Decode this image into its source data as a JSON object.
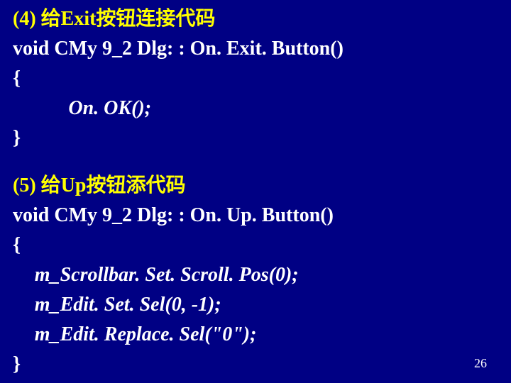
{
  "section4": {
    "heading": "(4) 给Exit按钮连接代码",
    "line1": "void CMy 9_2 Dlg: : On. Exit. Button()",
    "line2": "{",
    "call": "On. OK();",
    "line3": "}"
  },
  "section5": {
    "heading": "(5) 给Up按钮添代码",
    "line1": "void CMy 9_2 Dlg: : On. Up. Button()",
    "line2": "{",
    "call1": "m_Scrollbar. Set. Scroll. Pos(0);",
    "call2": "m_Edit. Set. Sel(0, -1);",
    "call3": "m_Edit. Replace. Sel(\"0\");",
    "line3": "}"
  },
  "page_number": "26"
}
